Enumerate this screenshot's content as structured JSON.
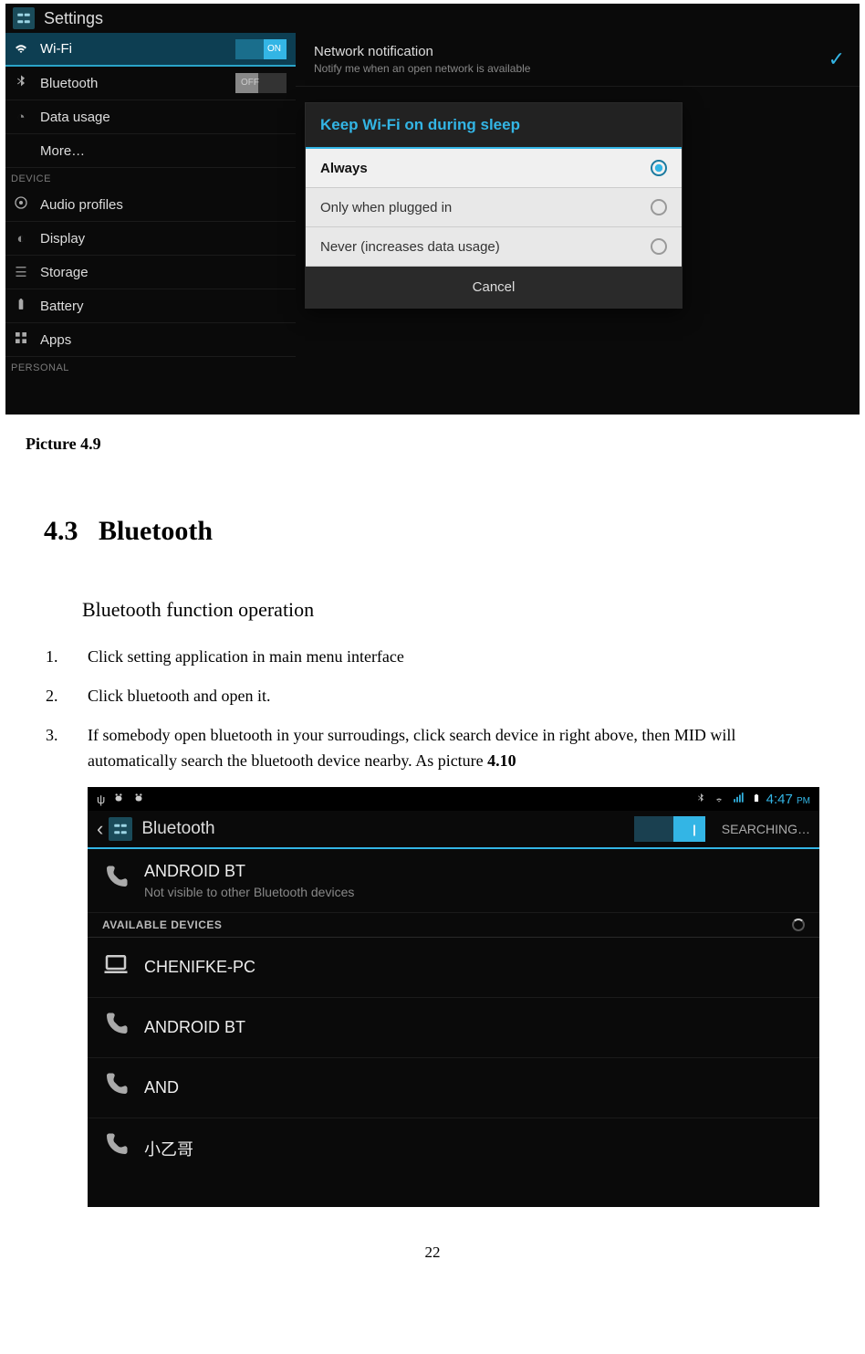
{
  "pic49": {
    "app_title": "Settings",
    "sidebar": {
      "wifi": {
        "label": "Wi-Fi",
        "toggle": "ON"
      },
      "bluetooth": {
        "label": "Bluetooth",
        "toggle": "OFF"
      },
      "data_usage": {
        "label": "Data usage"
      },
      "more": {
        "label": "More…"
      },
      "device_heading": "DEVICE",
      "audio": {
        "label": "Audio profiles"
      },
      "display": {
        "label": "Display"
      },
      "storage": {
        "label": "Storage"
      },
      "battery": {
        "label": "Battery"
      },
      "apps": {
        "label": "Apps"
      },
      "personal_heading": "PERSONAL"
    },
    "content": {
      "network_notification": {
        "title": "Network notification",
        "subtitle": "Notify me when an open network is available"
      }
    },
    "dialog": {
      "title": "Keep Wi-Fi on during sleep",
      "options": [
        "Always",
        "Only when plugged in",
        "Never (increases data usage)"
      ],
      "selected": 0,
      "cancel": "Cancel"
    }
  },
  "caption49": "Picture 4.9",
  "section": {
    "number": "4.3",
    "title": "Bluetooth"
  },
  "subheading": "Bluetooth function operation",
  "steps": [
    {
      "num": "1.",
      "text": "Click setting application in main menu interface"
    },
    {
      "num": "2.",
      "text": "Click bluetooth and open it."
    },
    {
      "num": "3.",
      "text_a": "If somebody open bluetooth in your surroudings, click search device in right above, then MID will automatically search the bluetooth device nearby. As picture ",
      "text_b": "4.10"
    }
  ],
  "pic410": {
    "statusbar": {
      "time": "4:47",
      "ampm": "PM"
    },
    "titlebar": {
      "title": "Bluetooth",
      "status": "SEARCHING…",
      "toggle": "|"
    },
    "my_device": {
      "name": "ANDROID BT",
      "subtitle": "Not visible to other Bluetooth devices"
    },
    "available_heading": "AVAILABLE DEVICES",
    "devices": [
      {
        "icon": "laptop",
        "name": "CHENIFKE-PC"
      },
      {
        "icon": "phone",
        "name": "ANDROID BT"
      },
      {
        "icon": "phone",
        "name": "AND"
      },
      {
        "icon": "phone",
        "name": "小乙哥"
      }
    ]
  },
  "page_number": "22"
}
